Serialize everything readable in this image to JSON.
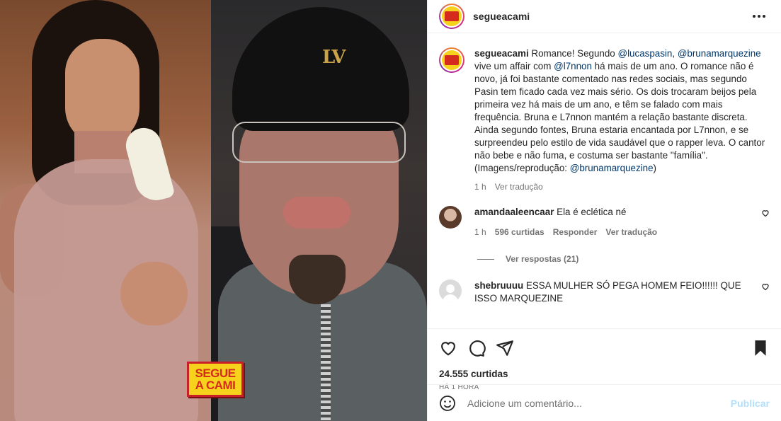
{
  "media": {
    "watermark_line1": "SEGUE",
    "watermark_line2": "A CAMI",
    "beanie_logo": "LV"
  },
  "header": {
    "username": "segueacami",
    "avatar_text": "SEGUE A CAMI"
  },
  "caption": {
    "username": "segueacami",
    "text_1": " Romance! Segundo ",
    "mention_1": "@lucaspasin",
    "text_2": ", ",
    "mention_2": "@brunamarquezine",
    "text_3": " vive um affair com ",
    "mention_3": "@l7nnon",
    "text_4": " há mais de um ano. O romance não é novo, já foi bastante comentado nas redes sociais, mas segundo Pasin tem ficado cada vez mais sério. Os dois trocaram beijos pela primeira vez há mais de um ano, e têm se falado com mais frequência. Bruna e L7nnon mantém a relação bastante discreta. Ainda segundo fontes, Bruna estaria encantada por L7nnon, e se surpreendeu pelo estilo de vida saudável que o rapper leva. O cantor não bebe e não fuma, e costuma ser bastante \"família\".",
    "text_5": "(Imagens/reprodução: ",
    "mention_4": "@brunamarquezine",
    "text_6": ")",
    "time": "1 h",
    "translate": "Ver tradução"
  },
  "comments": [
    {
      "username": "amandaaleencaar",
      "text": "Ela é eclética né",
      "time": "1 h",
      "likes": "596 curtidas",
      "reply": "Responder",
      "translate": "Ver tradução",
      "view_replies": "Ver respostas (21)"
    },
    {
      "username": "shebruuuu",
      "text": "ESSA MULHER SÓ PEGA HOMEM FEIO!!!!!! QUE ISSO MARQUEZINE"
    }
  ],
  "actions": {
    "likes": "24.555 curtidas",
    "time": "HÁ 1 HORA",
    "comment_placeholder": "Adicione um comentário...",
    "post_label": "Publicar"
  },
  "colors": {
    "mention": "#00376b",
    "post_disabled": "#b2dffc",
    "brand_yellow": "#f6d21c",
    "brand_red": "#d52b1e"
  }
}
